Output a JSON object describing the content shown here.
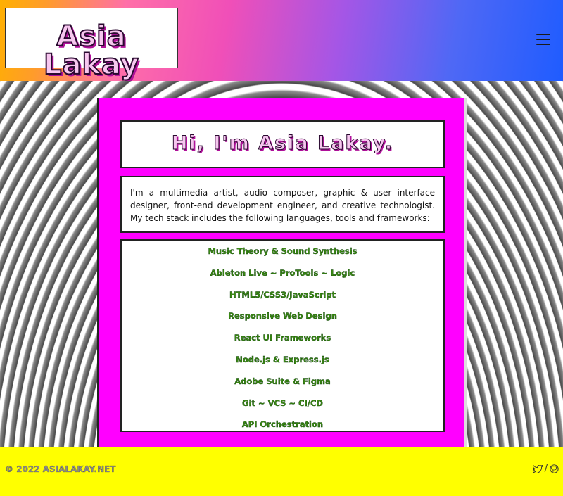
{
  "header": {
    "logo_text": "Asia Lakay",
    "menu_icon": "hamburger-menu-icon"
  },
  "main": {
    "title": "Hi, I'm Asia Lakay.",
    "intro": "I'm a multimedia artist, audio composer, graphic & user interface designer, front-end development engineer, and creative technologist. My tech stack includes the following languages, tools and frameworks:",
    "stack": [
      "Music Theory & Sound Synthesis",
      "Ableton Live ~ ProTools ~ Logic",
      "HTML5/CSS3/JavaScript",
      "Responsive Web Design",
      "React UI Frameworks",
      "Node.js & Express.js",
      "Adobe Suite & Figma",
      "Git ~ VCS ~ CI/CD",
      "API Orchestration"
    ]
  },
  "footer": {
    "copyright": "© 2022 ASIALAKAY.NET",
    "separator": "/",
    "icons": [
      "twitter-icon",
      "github-icon"
    ]
  },
  "colors": {
    "card": "#ff00ff",
    "footer": "#ffff00",
    "stack_text": "#3c8a14"
  }
}
